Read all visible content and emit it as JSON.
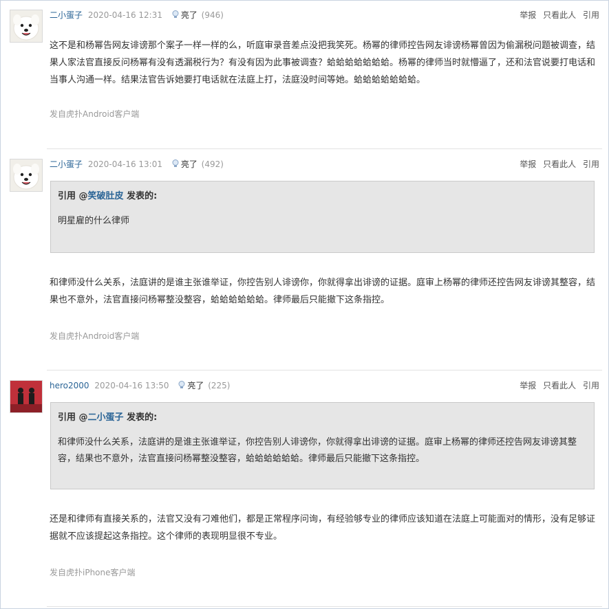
{
  "actions": {
    "report": "举报",
    "only_this": "只看此人",
    "quote": "引用"
  },
  "posts": [
    {
      "user": "二小蛋子",
      "time": "2020-04-16 12:31",
      "light_label": "亮了",
      "light_count": "(946)",
      "body": "这不是和杨幂告网友诽谤那个案子一样一样的么，听庭审录音差点没把我笑死。杨幂的律师控告网友诽谤杨幂曾因为偷漏税问题被调查，结果人家法官直接反问杨幂有没有透漏税行为？有没有因为此事被调查？蛤蛤蛤蛤蛤蛤蛤。杨幂的律师当时就懵逼了，还和法官说要打电话和当事人沟通一样。结果法官告诉她要打电话就在法庭上打，法庭没时间等她。蛤蛤蛤蛤蛤蛤蛤。",
      "source": "发自虎扑Android客户端"
    },
    {
      "user": "二小蛋子",
      "time": "2020-04-16 13:01",
      "light_label": "亮了",
      "light_count": "(492)",
      "quote_prefix": "引用 @",
      "quote_user": "笑破肚皮",
      "quote_suffix": " 发表的:",
      "quote_text": "明星雇的什么律师",
      "body": "和律师没什么关系，法庭讲的是谁主张谁举证，你控告别人诽谤你，你就得拿出诽谤的证据。庭审上杨幂的律师还控告网友诽谤其整容，结果也不意外，法官直接问杨幂整没整容，蛤蛤蛤蛤蛤蛤。律师最后只能撤下这条指控。",
      "source": "发自虎扑Android客户端"
    },
    {
      "user": "hero2000",
      "time": "2020-04-16 13:50",
      "light_label": "亮了",
      "light_count": "(225)",
      "quote_prefix": "引用 @",
      "quote_user": "二小蛋子",
      "quote_suffix": " 发表的:",
      "quote_text": "和律师没什么关系，法庭讲的是谁主张谁举证，你控告别人诽谤你，你就得拿出诽谤的证据。庭审上杨幂的律师还控告网友诽谤其整容，结果也不意外，法官直接问杨幂整没整容，蛤蛤蛤蛤蛤蛤。律师最后只能撤下这条指控。",
      "body": "还是和律师有直接关系的，法官又没有刁难他们，都是正常程序问询，有经验够专业的律师应该知道在法庭上可能面对的情形，没有足够证据就不应该提起这条指控。这个律师的表现明显很不专业。",
      "source": "发自虎扑iPhone客户端"
    }
  ]
}
